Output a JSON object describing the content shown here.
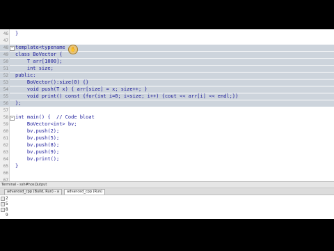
{
  "editor": {
    "lines": [
      {
        "n": "46",
        "text": "}",
        "sel": false
      },
      {
        "n": "47",
        "text": "",
        "sel": false
      },
      {
        "n": "48",
        "text": "template<typename",
        "sel": true
      },
      {
        "n": "49",
        "text": "class BoVector {",
        "sel": true
      },
      {
        "n": "50",
        "text": "    T arr[1000];",
        "sel": true
      },
      {
        "n": "51",
        "text": "    int size;",
        "sel": true
      },
      {
        "n": "52",
        "text": "public:",
        "sel": true
      },
      {
        "n": "53",
        "text": "    BoVector():size(0) {}",
        "sel": true
      },
      {
        "n": "54",
        "text": "    void push(T x) { arr[size] = x; size++; }",
        "sel": true
      },
      {
        "n": "55",
        "text": "    void print() const {for(int i=0; i<size; i++) {cout << arr[i] << endl;}}",
        "sel": true
      },
      {
        "n": "56",
        "text": "};",
        "sel": true
      },
      {
        "n": "57",
        "text": "",
        "sel": false
      },
      {
        "n": "58",
        "text": "int main() {  // Code bloat",
        "sel": false
      },
      {
        "n": "59",
        "text": "    BoVector<int> bv;",
        "sel": false
      },
      {
        "n": "60",
        "text": "    bv.push(2);",
        "sel": false
      },
      {
        "n": "61",
        "text": "    bv.push(5);",
        "sel": false
      },
      {
        "n": "62",
        "text": "    bv.push(8);",
        "sel": false
      },
      {
        "n": "63",
        "text": "    bv.push(9);",
        "sel": false
      },
      {
        "n": "64",
        "text": "    bv.print();",
        "sel": false
      },
      {
        "n": "65",
        "text": "}",
        "sel": false
      },
      {
        "n": "66",
        "text": "",
        "sel": false
      },
      {
        "n": "67",
        "text": "",
        "sel": false
      }
    ]
  },
  "bottom": {
    "tab1": "Terminal - ssh#hos...",
    "tab2": "Output",
    "output_tabs": [
      {
        "label": "advanced_cpp (Build, Run) - a",
        "active": false
      },
      {
        "label": "advanced_cpp (Run)",
        "active": true
      }
    ],
    "output_lines": [
      "2",
      "5",
      "8",
      "9"
    ]
  }
}
